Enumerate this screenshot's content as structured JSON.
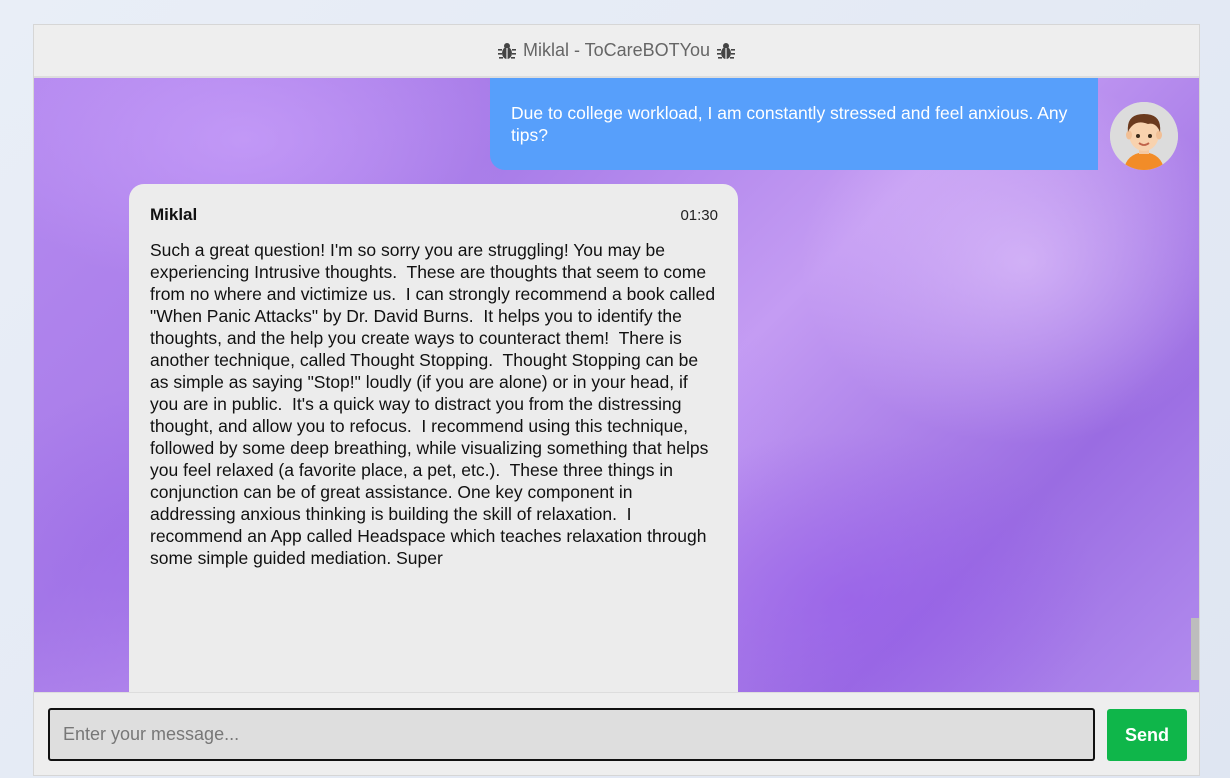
{
  "header": {
    "title": "Miklal - ToCareBOTYou",
    "left_icon": "bug-icon",
    "right_icon": "bug-icon"
  },
  "messages": {
    "user": {
      "text": "Due to college workload, I am constantly stressed and feel anxious. Any tips?",
      "avatar_icon": "user-avatar"
    },
    "bot": {
      "name": "Miklal",
      "time": "01:30",
      "text": "Such a great question! I'm so sorry you are struggling! You may be experiencing Intrusive thoughts.  These are thoughts that seem to come from no where and victimize us.  I can strongly recommend a book called \"When Panic Attacks\" by Dr. David Burns.  It helps you to identify the thoughts, and the help you create ways to counteract them!  There is another technique, called Thought Stopping.  Thought Stopping can be as simple as saying \"Stop!\" loudly (if you are alone) or in your head, if you are in public.  It's a quick way to distract you from the distressing thought, and allow you to refocus.  I recommend using this technique, followed by some deep breathing, while visualizing something that helps you feel relaxed (a favorite place, a pet, etc.).  These three things in conjunction can be of great assistance. One key component in addressing anxious thinking is building the skill of relaxation.  I recommend an App called Headspace which teaches relaxation through some simple guided mediation. Super"
    }
  },
  "composer": {
    "placeholder": "Enter your message...",
    "value": "",
    "send_label": "Send"
  },
  "colors": {
    "user_bubble": "#579ffb",
    "bot_bubble": "#ececec",
    "send_button": "#0fb64a"
  }
}
